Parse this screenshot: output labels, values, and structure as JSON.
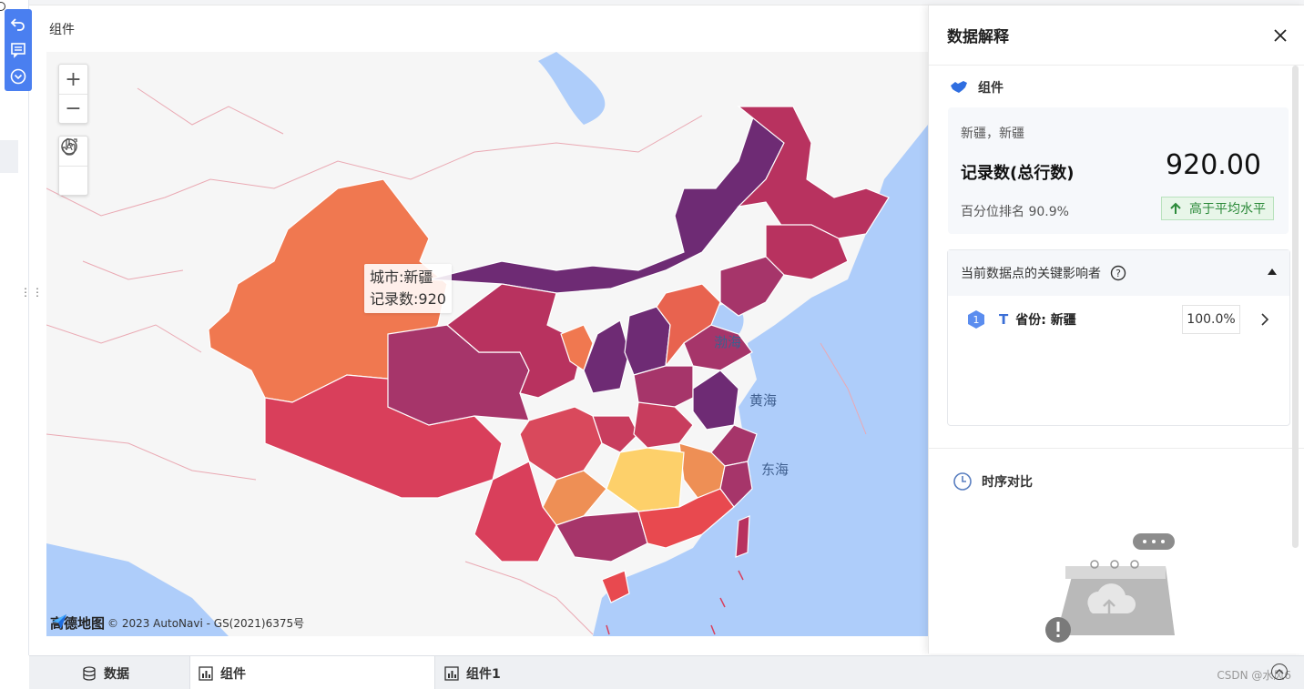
{
  "canvas": {
    "title": "组件"
  },
  "map": {
    "zoom_in": "+",
    "zoom_out": "−",
    "tooltip": {
      "line1": "城市:新疆",
      "line2": "记录数:920"
    },
    "sea_labels": {
      "bohai": "渤海",
      "huanghai": "黄海",
      "donghai": "东海"
    },
    "attribution_logo": "高德地图",
    "attribution_text": "© 2023 AutoNavi - GS(2021)6375号",
    "colors": {
      "sea": "#aecdfa",
      "land": "#f6f6f6",
      "xinjiang": "#f07850",
      "hunan": "#fdd06a"
    }
  },
  "panel": {
    "title": "数据解释",
    "component_label": "组件",
    "stat": {
      "breadcrumb": "新疆，新疆",
      "metric": "记录数(总行数)",
      "value": "920.00",
      "rank": "百分位排名 90.9%",
      "badge": "高于平均水平"
    },
    "influencers": {
      "title": "当前数据点的关键影响者",
      "items": [
        {
          "rank": "1",
          "type": "T",
          "name": "省份: 新疆",
          "percent": "100.0%"
        }
      ]
    },
    "timeseries_label": "时序对比"
  },
  "bottom_tabs": {
    "data": "数据",
    "component": "组件",
    "component1": "组件1"
  },
  "watermark": "CSDN @水风6"
}
